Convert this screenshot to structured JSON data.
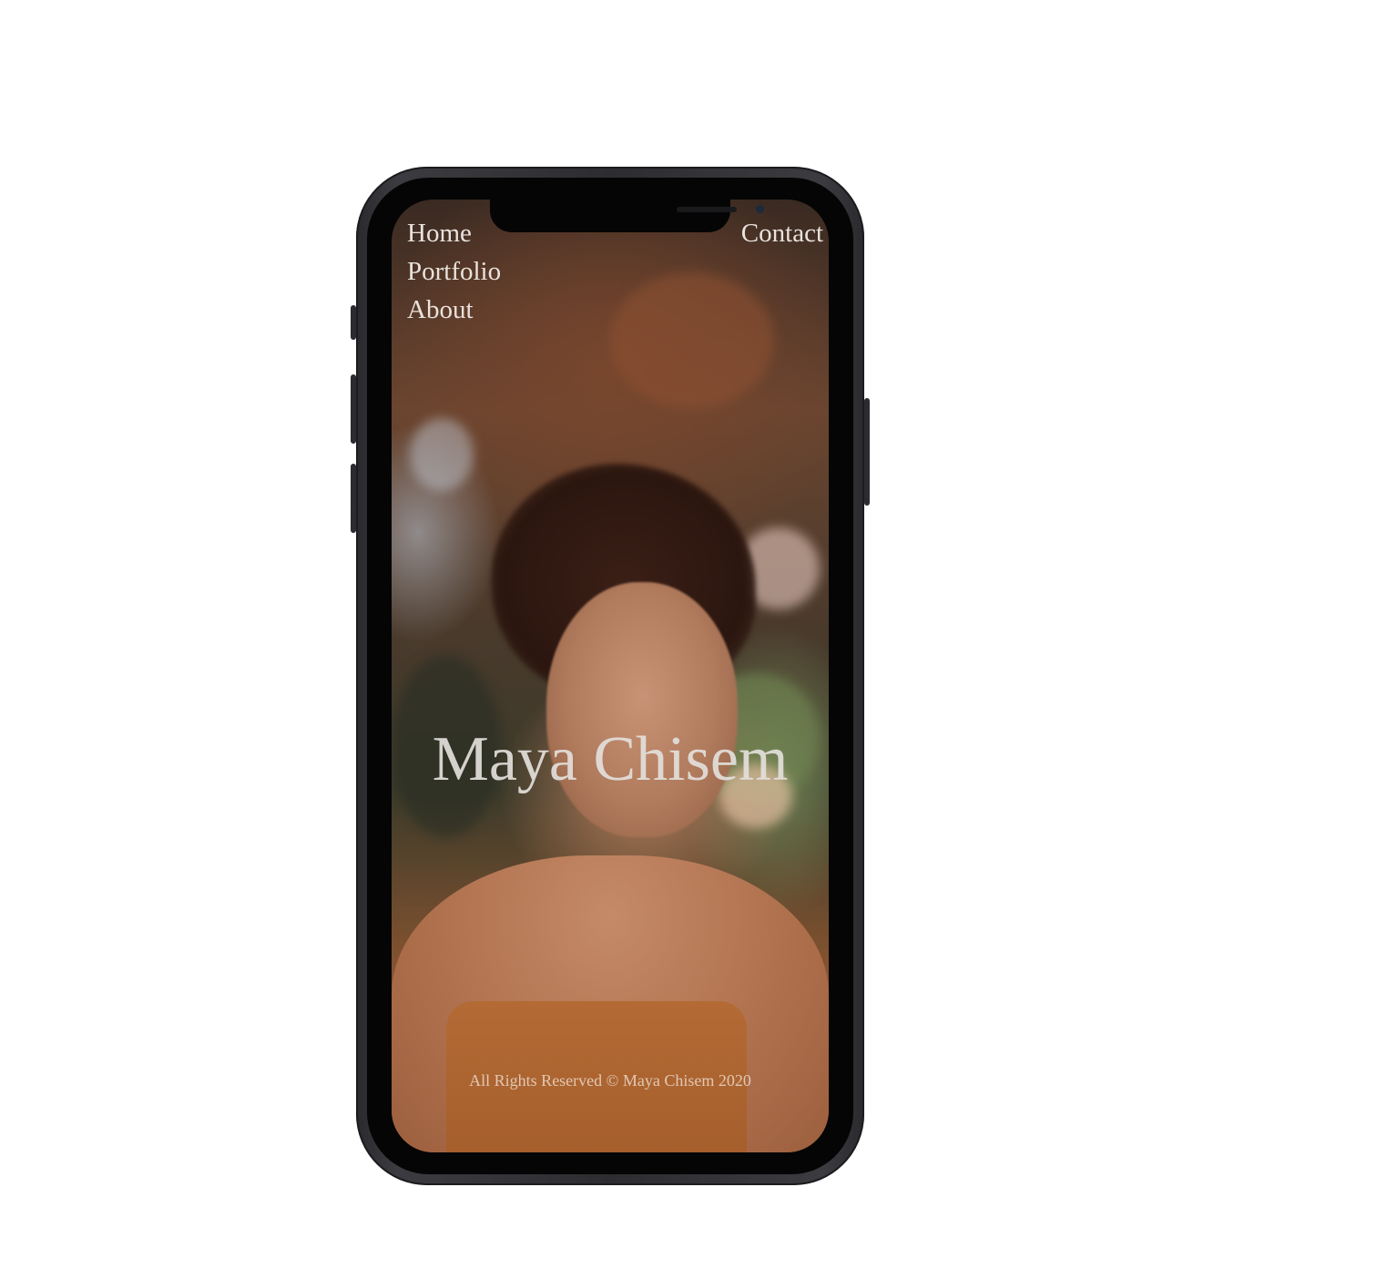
{
  "nav": {
    "home_label": "Home",
    "portfolio_label": "Portfolio",
    "about_label": "About",
    "contact_label": "Contact"
  },
  "hero": {
    "title": "Maya Chisem"
  },
  "footer": {
    "text": "All Rights Reserved © Maya Chisem 2020"
  },
  "colors": {
    "background": "#ffffff",
    "device_frame": "#2d2d31",
    "text_light": "#e9e2dc"
  }
}
